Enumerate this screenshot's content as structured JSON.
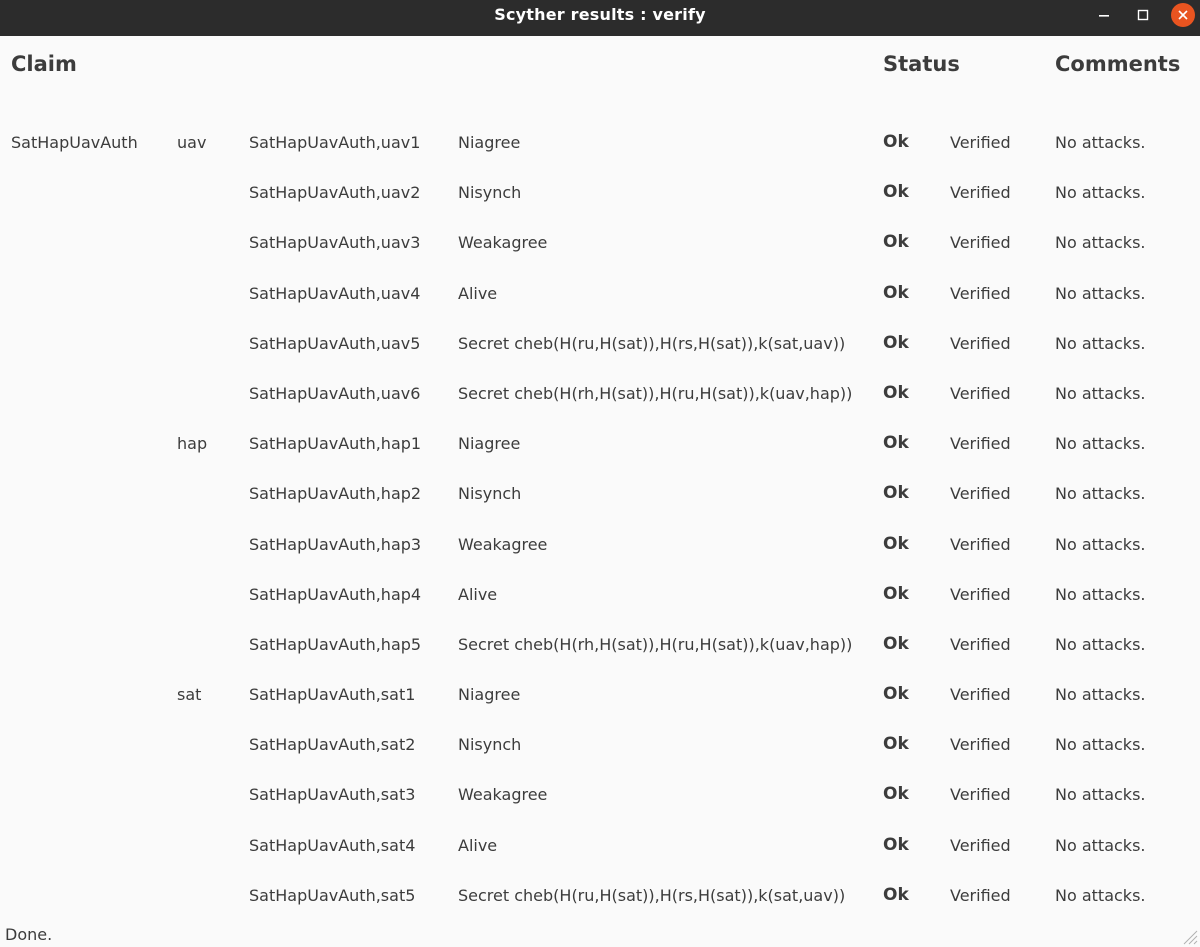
{
  "window": {
    "title": "Scyther results : verify",
    "close_color": "#e95420"
  },
  "headers": {
    "claim": "Claim",
    "status": "Status",
    "comments": "Comments"
  },
  "colors": {
    "ok": "#2db52d",
    "titlebar": "#2c2c2c",
    "background": "#fafafa"
  },
  "rows": [
    {
      "protocol": "SatHapUavAuth",
      "role": "uav",
      "id": "SatHapUavAuth,uav1",
      "claim": "Niagree",
      "status": "Ok",
      "verdict": "Verified",
      "comment": "No attacks."
    },
    {
      "protocol": "",
      "role": "",
      "id": "SatHapUavAuth,uav2",
      "claim": "Nisynch",
      "status": "Ok",
      "verdict": "Verified",
      "comment": "No attacks."
    },
    {
      "protocol": "",
      "role": "",
      "id": "SatHapUavAuth,uav3",
      "claim": "Weakagree",
      "status": "Ok",
      "verdict": "Verified",
      "comment": "No attacks."
    },
    {
      "protocol": "",
      "role": "",
      "id": "SatHapUavAuth,uav4",
      "claim": "Alive",
      "status": "Ok",
      "verdict": "Verified",
      "comment": "No attacks."
    },
    {
      "protocol": "",
      "role": "",
      "id": "SatHapUavAuth,uav5",
      "claim": "Secret cheb(H(ru,H(sat)),H(rs,H(sat)),k(sat,uav))",
      "status": "Ok",
      "verdict": "Verified",
      "comment": "No attacks."
    },
    {
      "protocol": "",
      "role": "",
      "id": "SatHapUavAuth,uav6",
      "claim": "Secret cheb(H(rh,H(sat)),H(ru,H(sat)),k(uav,hap))",
      "status": "Ok",
      "verdict": "Verified",
      "comment": "No attacks."
    },
    {
      "protocol": "",
      "role": "hap",
      "id": "SatHapUavAuth,hap1",
      "claim": "Niagree",
      "status": "Ok",
      "verdict": "Verified",
      "comment": "No attacks."
    },
    {
      "protocol": "",
      "role": "",
      "id": "SatHapUavAuth,hap2",
      "claim": "Nisynch",
      "status": "Ok",
      "verdict": "Verified",
      "comment": "No attacks."
    },
    {
      "protocol": "",
      "role": "",
      "id": "SatHapUavAuth,hap3",
      "claim": "Weakagree",
      "status": "Ok",
      "verdict": "Verified",
      "comment": "No attacks."
    },
    {
      "protocol": "",
      "role": "",
      "id": "SatHapUavAuth,hap4",
      "claim": "Alive",
      "status": "Ok",
      "verdict": "Verified",
      "comment": "No attacks."
    },
    {
      "protocol": "",
      "role": "",
      "id": "SatHapUavAuth,hap5",
      "claim": "Secret cheb(H(rh,H(sat)),H(ru,H(sat)),k(uav,hap))",
      "status": "Ok",
      "verdict": "Verified",
      "comment": "No attacks."
    },
    {
      "protocol": "",
      "role": "sat",
      "id": "SatHapUavAuth,sat1",
      "claim": "Niagree",
      "status": "Ok",
      "verdict": "Verified",
      "comment": "No attacks."
    },
    {
      "protocol": "",
      "role": "",
      "id": "SatHapUavAuth,sat2",
      "claim": "Nisynch",
      "status": "Ok",
      "verdict": "Verified",
      "comment": "No attacks."
    },
    {
      "protocol": "",
      "role": "",
      "id": "SatHapUavAuth,sat3",
      "claim": "Weakagree",
      "status": "Ok",
      "verdict": "Verified",
      "comment": "No attacks."
    },
    {
      "protocol": "",
      "role": "",
      "id": "SatHapUavAuth,sat4",
      "claim": "Alive",
      "status": "Ok",
      "verdict": "Verified",
      "comment": "No attacks."
    },
    {
      "protocol": "",
      "role": "",
      "id": "SatHapUavAuth,sat5",
      "claim": "Secret cheb(H(ru,H(sat)),H(rs,H(sat)),k(sat,uav))",
      "status": "Ok",
      "verdict": "Verified",
      "comment": "No attacks."
    }
  ],
  "statusbar": {
    "text": "Done."
  },
  "icons": {
    "minimize": "minimize-icon",
    "maximize": "maximize-icon",
    "close": "close-icon",
    "resize": "resize-grip-icon"
  }
}
